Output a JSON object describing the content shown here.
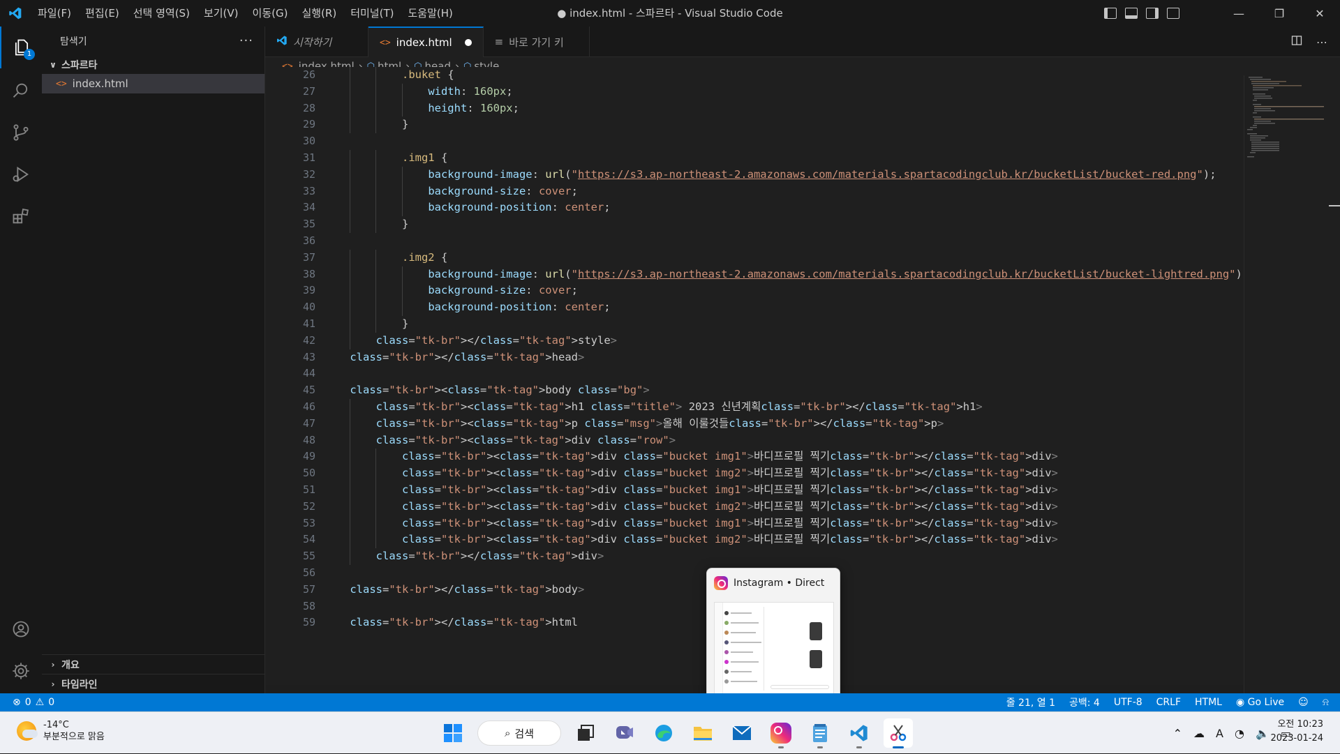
{
  "titlebar": {
    "menu": [
      "파일(F)",
      "편집(E)",
      "선택 영역(S)",
      "보기(V)",
      "이동(G)",
      "실행(R)",
      "터미널(T)",
      "도움말(H)"
    ],
    "title": "● index.html - 스파르타 - Visual Studio Code"
  },
  "activitybar": {
    "explorer_badge": "1",
    "icons": [
      "explorer-icon",
      "search-icon",
      "source-control-icon",
      "run-debug-icon",
      "extensions-icon",
      "account-icon",
      "gear-icon"
    ]
  },
  "sidebar": {
    "title": "탐색기",
    "more": "···",
    "folder": "스파르타",
    "file": "index.html",
    "outline": "개요",
    "timeline": "타임라인"
  },
  "tabs": [
    {
      "label": "시작하기",
      "icon": "vscode-logo-icon",
      "active": false
    },
    {
      "label": "index.html",
      "icon": "html-icon",
      "active": true,
      "dirty": true
    },
    {
      "label": "바로 가기 키",
      "icon": "keyboard-list-icon",
      "active": false
    }
  ],
  "breadcrumb": [
    "index.html",
    "html",
    "head",
    "style"
  ],
  "editor": {
    "line_numbers": [
      "26",
      "27",
      "28",
      "29",
      "30",
      "31",
      "32",
      "33",
      "34",
      "35",
      "36",
      "37",
      "38",
      "39",
      "40",
      "41",
      "42",
      "43",
      "44",
      "45",
      "46",
      "47",
      "48",
      "49",
      "50",
      "51",
      "52",
      "53",
      "54",
      "55",
      "56",
      "57",
      "58",
      "59"
    ],
    "lines": [
      "            .buket {",
      "                width: 160px;",
      "                height: 160px;",
      "            }",
      "",
      "            .img1 {",
      "                background-image: url(\"https://s3.ap-northeast-2.amazonaws.com/materials.spartacodingclub.kr/bucketList/bucket-red.png\");",
      "                background-size: cover;",
      "                background-position: center;",
      "            }",
      "",
      "            .img2 {",
      "                background-image: url(\"https://s3.ap-northeast-2.amazonaws.com/materials.spartacodingclub.kr/bucketList/bucket-lightred.png\")",
      "                background-size: cover;",
      "                background-position: center;",
      "            }",
      "        </style>",
      "    </head>",
      "",
      "    <body class=\"bg\">",
      "        <h1 class=\"title\"> 2023 신년계획</h1>",
      "        <p class=\"msg\">올해 이룰것들</p>",
      "        <div class=\"row\">",
      "            <div class=\"bucket img1\">바디프로필 찍기</div>",
      "            <div class=\"bucket img2\">바디프로필 찍기</div>",
      "            <div class=\"bucket img1\">바디프로필 찍기</div>",
      "            <div class=\"bucket img2\">바디프로필 찍기</div>",
      "            <div class=\"bucket img1\">바디프로필 찍기</div>",
      "            <div class=\"bucket img2\">바디프로필 찍기</div>",
      "        </div>",
      "",
      "    </body>",
      "",
      "    </html"
    ]
  },
  "statusbar": {
    "errors": "0",
    "warnings": "0",
    "position": "줄 21, 열 1",
    "spaces": "공백: 4",
    "encoding": "UTF-8",
    "eol": "CRLF",
    "language": "HTML",
    "golive": "Go Live"
  },
  "preview": {
    "title": "Instagram • Direct"
  },
  "taskbar": {
    "temperature": "-14°C",
    "weather_desc": "부분적으로 맑음",
    "search": "검색",
    "time": "오전 10:23",
    "date": "2023-01-24",
    "tray_ime": "A"
  },
  "colors": {
    "accent": "#0078d4",
    "editor_bg": "#1f1f1f",
    "sidebar_bg": "#181818"
  }
}
